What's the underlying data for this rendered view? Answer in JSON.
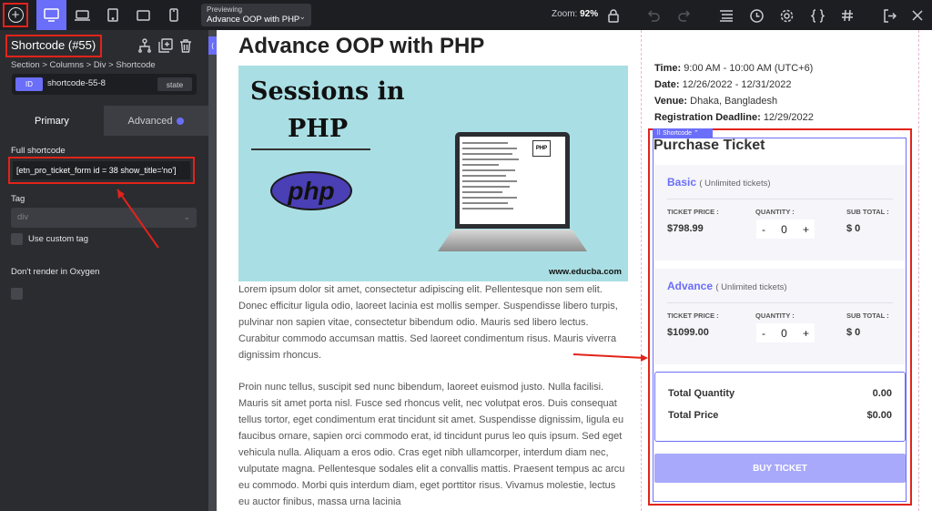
{
  "topbar": {
    "add_icon": "plus-circle-icon",
    "devices": [
      "desktop-icon",
      "laptop-icon",
      "tablet-icon",
      "tablet-landscape-icon",
      "phone-icon"
    ],
    "preview_label": "Previewing",
    "preview_page": "Advance OOP with PHP",
    "zoom_label": "Zoom:",
    "zoom_value": "92%",
    "accent": "#6b6ef8"
  },
  "panel": {
    "element_title": "Shortcode (#55)",
    "breadcrumb": "Section > Columns > Div > Shortcode",
    "id_pill": "ID",
    "id_value": "shortcode-55-8",
    "state_label": "state",
    "tab_primary": "Primary",
    "tab_advanced": "Advanced",
    "full_shortcode_label": "Full shortcode",
    "full_shortcode_value": "[etn_pro_ticket_form id = 38 show_title='no']",
    "tag_label": "Tag",
    "tag_value": "div",
    "custom_tag_label": "Use custom tag",
    "dont_render_label": "Don't render in Oxygen"
  },
  "canvas": {
    "post_title": "Advance OOP with PHP",
    "hero": {
      "title_line1": "Sessions in",
      "title_line2": "PHP",
      "logo_text": "php",
      "screen_badge": "PHP",
      "url": "www.educba.com"
    },
    "paragraph1": "Lorem ipsum dolor sit amet, consectetur adipiscing elit. Pellentesque non sem elit. Donec efficitur ligula odio, laoreet lacinia est mollis semper. Suspendisse libero turpis, pulvinar non sapien vitae, consectetur bibendum odio. Mauris sed libero lectus. Curabitur commodo accumsan mattis. Sed laoreet condimentum risus. Mauris viverra dignissim rhoncus.",
    "paragraph2": "Proin nunc tellus, suscipit sed nunc bibendum, laoreet euismod justo. Nulla facilisi. Mauris sit amet porta nisl. Fusce sed rhoncus velit, nec volutpat eros. Duis consequat tellus tortor, eget condimentum erat tincidunt sit amet. Suspendisse dignissim, ligula eu faucibus ornare, sapien orci commodo erat, id tincidunt purus leo quis ipsum. Sed eget vehicula nulla. Aliquam a eros odio. Cras eget nibh ullamcorper, interdum diam nec, vulputate magna. Pellentesque sodales elit a convallis mattis. Praesent tempus ac arcu eu commodo. Morbi quis interdum diam, eget porttitor risus. Vivamus molestie, lectus eu auctor finibus, massa urna lacinia",
    "event": {
      "time_label": "Time:",
      "time_value": "9:00 AM - 10:00 AM (UTC+6)",
      "date_label": "Date:",
      "date_value": "12/26/2022 - 12/31/2022",
      "venue_label": "Venue:",
      "venue_value": "Dhaka, Bangladesh",
      "deadline_label": "Registration Deadline:",
      "deadline_value": "12/29/2022"
    },
    "shortcode_tag": "Shortcode",
    "purchase_title": "Purchase Ticket",
    "tickets": [
      {
        "name": "Basic",
        "note": "( Unlimited tickets)",
        "price_label": "TICKET PRICE :",
        "price": "$798.99",
        "qty_label": "QUANTITY :",
        "qty": "0",
        "minus": "-",
        "plus": "+",
        "sub_label": "SUB TOTAL :",
        "subtotal": "$ 0"
      },
      {
        "name": "Advance",
        "note": "( Unlimited tickets)",
        "price_label": "TICKET PRICE :",
        "price": "$1099.00",
        "qty_label": "QUANTITY :",
        "qty": "0",
        "minus": "-",
        "plus": "+",
        "sub_label": "SUB TOTAL :",
        "subtotal": "$ 0"
      }
    ],
    "total_qty_label": "Total Quantity",
    "total_qty_value": "0.00",
    "total_price_label": "Total Price",
    "total_price_value": "$0.00",
    "buy_label": "BUY TICKET"
  }
}
